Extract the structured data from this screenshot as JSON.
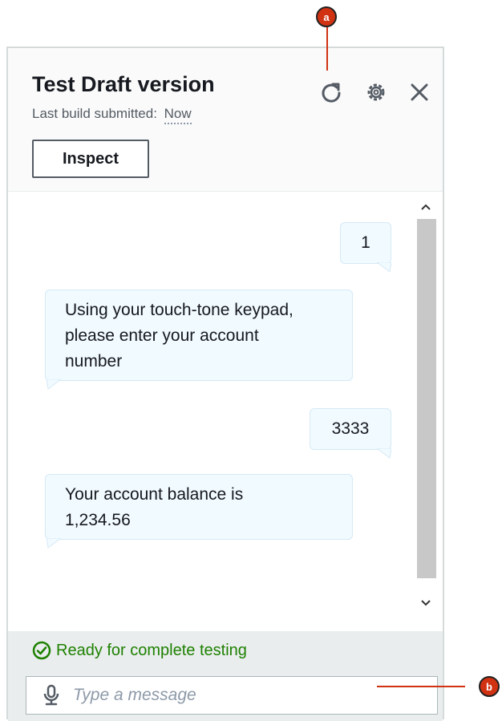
{
  "header": {
    "title": "Test Draft version",
    "subtitle_prefix": "Last build submitted:",
    "subtitle_value": "Now",
    "inspect_label": "Inspect"
  },
  "header_icons": [
    "refresh-icon",
    "settings-icon",
    "close-icon"
  ],
  "messages": [
    {
      "sender": "user",
      "text": "1"
    },
    {
      "sender": "bot",
      "lines": [
        "Using your touch-tone keypad,",
        "please enter your account",
        "number"
      ]
    },
    {
      "sender": "user",
      "text": "3333"
    },
    {
      "sender": "bot",
      "lines": [
        "Your account balance is",
        "1,234.56"
      ]
    }
  ],
  "footer": {
    "status": "Ready for complete testing",
    "placeholder": "Type a message"
  },
  "callouts": {
    "a": "a",
    "b": "b"
  },
  "colors": {
    "status": "#1d8102",
    "bubble": "#f1faff",
    "callout": "#d13212"
  }
}
